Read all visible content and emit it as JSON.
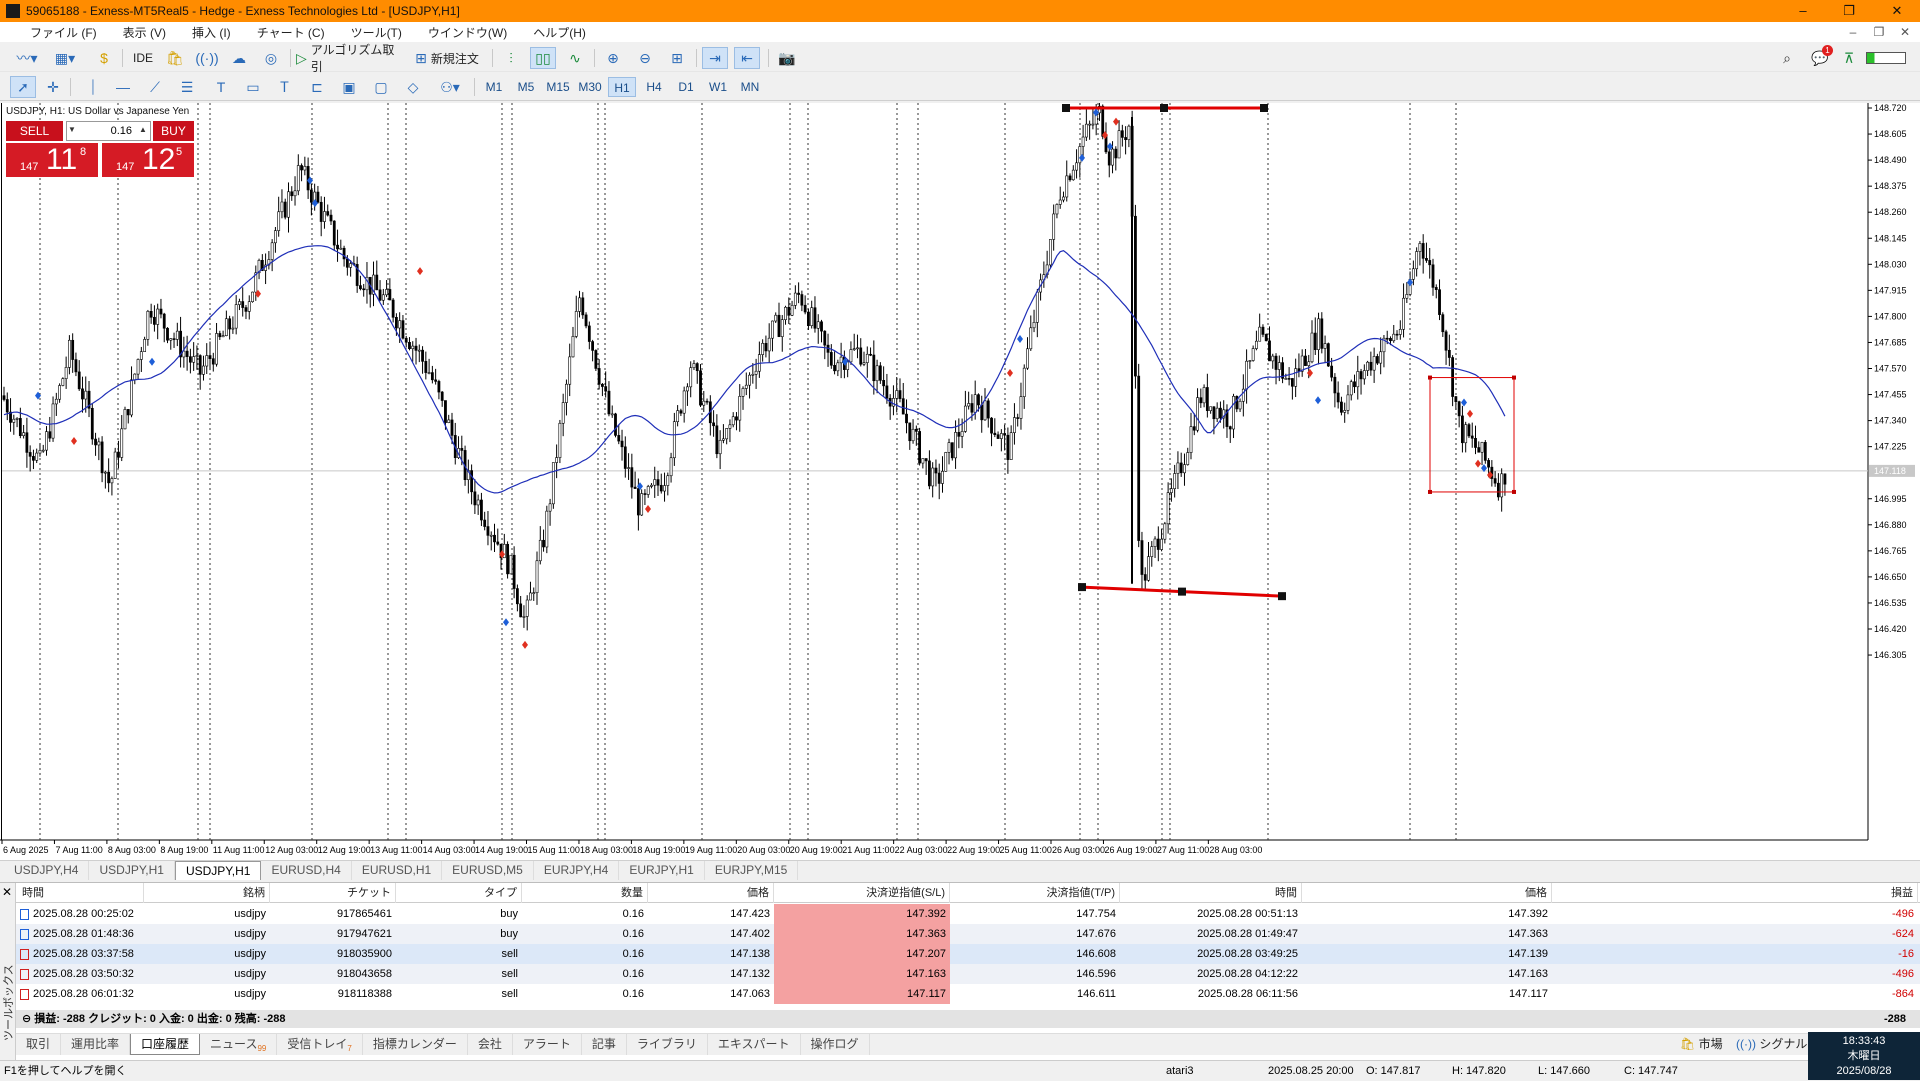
{
  "titlebar": {
    "title": "59065188 - Exness-MT5Real5 - Hedge - Exness Technologies Ltd - [USDJPY,H1]",
    "minimize": "–",
    "restore": "❐",
    "close": "✕"
  },
  "menu": {
    "items": [
      "ファイル (F)",
      "表示 (V)",
      "挿入 (I)",
      "チャート (C)",
      "ツール(T)",
      "ウインドウ(W)",
      "ヘルプ(H)"
    ],
    "mdi_min": "–",
    "mdi_restore": "❐",
    "mdi_close": "✕"
  },
  "toolbar": {
    "ide": "IDE",
    "algo": "アルゴリズム取引",
    "new_order": "新規注文",
    "notification_count": "1",
    "timeframes": [
      "M1",
      "M5",
      "M15",
      "M30",
      "H1",
      "H4",
      "D1",
      "W1",
      "MN"
    ],
    "active_timeframe": "H1"
  },
  "chart": {
    "symbol_line": "USDJPY, H1:  US Dollar vs Japanese Yen",
    "sell_label": "SELL",
    "buy_label": "BUY",
    "volume": "0.16",
    "sell_price_prefix": "147",
    "sell_price_big": "11",
    "sell_price_sup": "8",
    "buy_price_prefix": "147",
    "buy_price_big": "12",
    "buy_price_sup": "5",
    "current_price_label": "147.118",
    "price_ticks": [
      "148.720",
      "148.605",
      "148.490",
      "148.375",
      "148.260",
      "148.145",
      "148.030",
      "147.915",
      "147.800",
      "147.685",
      "147.570",
      "147.455",
      "147.340",
      "147.225",
      "146.995",
      "146.880",
      "146.765",
      "146.650",
      "146.535",
      "146.420",
      "146.305"
    ],
    "time_ticks": [
      "6 Aug 2025",
      "7 Aug 11:00",
      "8 Aug 03:00",
      "8 Aug 19:00",
      "11 Aug 11:00",
      "12 Aug 03:00",
      "12 Aug 19:00",
      "13 Aug 11:00",
      "14 Aug 03:00",
      "14 Aug 19:00",
      "15 Aug 11:00",
      "18 Aug 03:00",
      "18 Aug 19:00",
      "19 Aug 11:00",
      "20 Aug 03:00",
      "20 Aug 19:00",
      "21 Aug 11:00",
      "22 Aug 03:00",
      "22 Aug 19:00",
      "25 Aug 11:00",
      "26 Aug 03:00",
      "26 Aug 19:00",
      "27 Aug 11:00",
      "28 Aug 03:00"
    ],
    "colors": {
      "candle": "#000000",
      "ma": "#1f2fb8",
      "objects": "#e00000",
      "buy_marker": "#1e5fd8",
      "sell_marker": "#e03020"
    }
  },
  "chart_tabs": [
    "USDJPY,H4",
    "USDJPY,H1",
    "USDJPY,H1",
    "EURUSD,H4",
    "EURUSD,H1",
    "EURUSD,M5",
    "EURJPY,H4",
    "EURJPY,H1",
    "EURJPY,M15"
  ],
  "chart_tab_active": 2,
  "history": {
    "columns": [
      "時間",
      "銘柄",
      "チケット",
      "タイプ",
      "数量",
      "価格",
      "決済逆指値(S/L)",
      "決済指値(T/P)",
      "時間",
      "価格",
      "損益"
    ],
    "rows": [
      {
        "open_time": "2025.08.28 00:25:02",
        "symbol": "usdjpy",
        "ticket": "917865461",
        "type": "buy",
        "volume": "0.16",
        "price": "147.423",
        "sl": "147.392",
        "tp": "147.754",
        "close_time": "2025.08.28 00:51:13",
        "close_price": "147.392",
        "profit": "-496"
      },
      {
        "open_time": "2025.08.28 01:48:36",
        "symbol": "usdjpy",
        "ticket": "917947621",
        "type": "buy",
        "volume": "0.16",
        "price": "147.402",
        "sl": "147.363",
        "tp": "147.676",
        "close_time": "2025.08.28 01:49:47",
        "close_price": "147.363",
        "profit": "-624"
      },
      {
        "open_time": "2025.08.28 03:37:58",
        "symbol": "usdjpy",
        "ticket": "918035900",
        "type": "sell",
        "volume": "0.16",
        "price": "147.138",
        "sl": "147.207",
        "tp": "146.608",
        "close_time": "2025.08.28 03:49:25",
        "close_price": "147.139",
        "profit": "-16"
      },
      {
        "open_time": "2025.08.28 03:50:32",
        "symbol": "usdjpy",
        "ticket": "918043658",
        "type": "sell",
        "volume": "0.16",
        "price": "147.132",
        "sl": "147.163",
        "tp": "146.596",
        "close_time": "2025.08.28 04:12:22",
        "close_price": "147.163",
        "profit": "-496"
      },
      {
        "open_time": "2025.08.28 06:01:32",
        "symbol": "usdjpy",
        "ticket": "918118388",
        "type": "sell",
        "volume": "0.16",
        "price": "147.063",
        "sl": "147.117",
        "tp": "146.611",
        "close_time": "2025.08.28 06:11:56",
        "close_price": "147.117",
        "profit": "-864"
      }
    ],
    "summary": "損益: -288  クレジット: 0  入金: 0  出金: 0  残高: -288",
    "total": "-288"
  },
  "toolbox_label": "ツールボックス",
  "bottom_tabs": [
    {
      "label": "取引",
      "badge": ""
    },
    {
      "label": "運用比率",
      "badge": ""
    },
    {
      "label": "口座履歴",
      "badge": ""
    },
    {
      "label": "ニュース",
      "badge": "99"
    },
    {
      "label": "受信トレイ",
      "badge": "7"
    },
    {
      "label": "指標カレンダー",
      "badge": ""
    },
    {
      "label": "会社",
      "badge": ""
    },
    {
      "label": "アラート",
      "badge": ""
    },
    {
      "label": "記事",
      "badge": ""
    },
    {
      "label": "ライブラリ",
      "badge": ""
    },
    {
      "label": "エキスパート",
      "badge": ""
    },
    {
      "label": "操作ログ",
      "badge": ""
    }
  ],
  "bottom_tab_active": 2,
  "market_label": "市場",
  "signal_label": "シグナル",
  "status": {
    "help": "F1を押してヘルプを開く",
    "profile": "atari3",
    "bar_time": "2025.08.25 20:00",
    "open": "O: 147.817",
    "high": "H: 147.820",
    "low": "L: 147.660",
    "close": "C: 147.747"
  },
  "clock": {
    "time": "18:33:43",
    "day": "木曜日",
    "date": "2025/08/28"
  }
}
